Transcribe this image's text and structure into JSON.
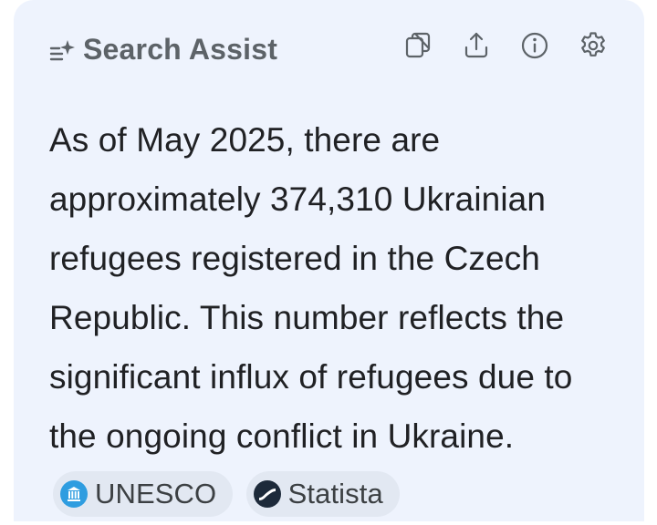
{
  "panel": {
    "title": "Search Assist",
    "title_icon": "assist-sparkle-icon",
    "toolbar": [
      {
        "name": "copy-button",
        "icon": "copy-icon"
      },
      {
        "name": "share-button",
        "icon": "share-icon"
      },
      {
        "name": "info-button",
        "icon": "info-icon"
      },
      {
        "name": "settings-button",
        "icon": "gear-icon"
      }
    ]
  },
  "answer": {
    "text": "As of May 2025, there are approximately 374,310 Ukrainian refugees registered in the Czech Republic. This number reflects the significant influx of refugees due to the ongoing conflict in Ukraine."
  },
  "sources": [
    {
      "label": "UNESCO",
      "icon": "unesco-logo-icon",
      "color": "#2f9de0"
    },
    {
      "label": "Statista",
      "icon": "statista-logo-icon",
      "color": "#1d2a3a"
    }
  ],
  "colors": {
    "card_bg": "#eef3fd",
    "chip_bg": "#e2e8f2",
    "title": "#5d6368",
    "text": "#202124"
  }
}
